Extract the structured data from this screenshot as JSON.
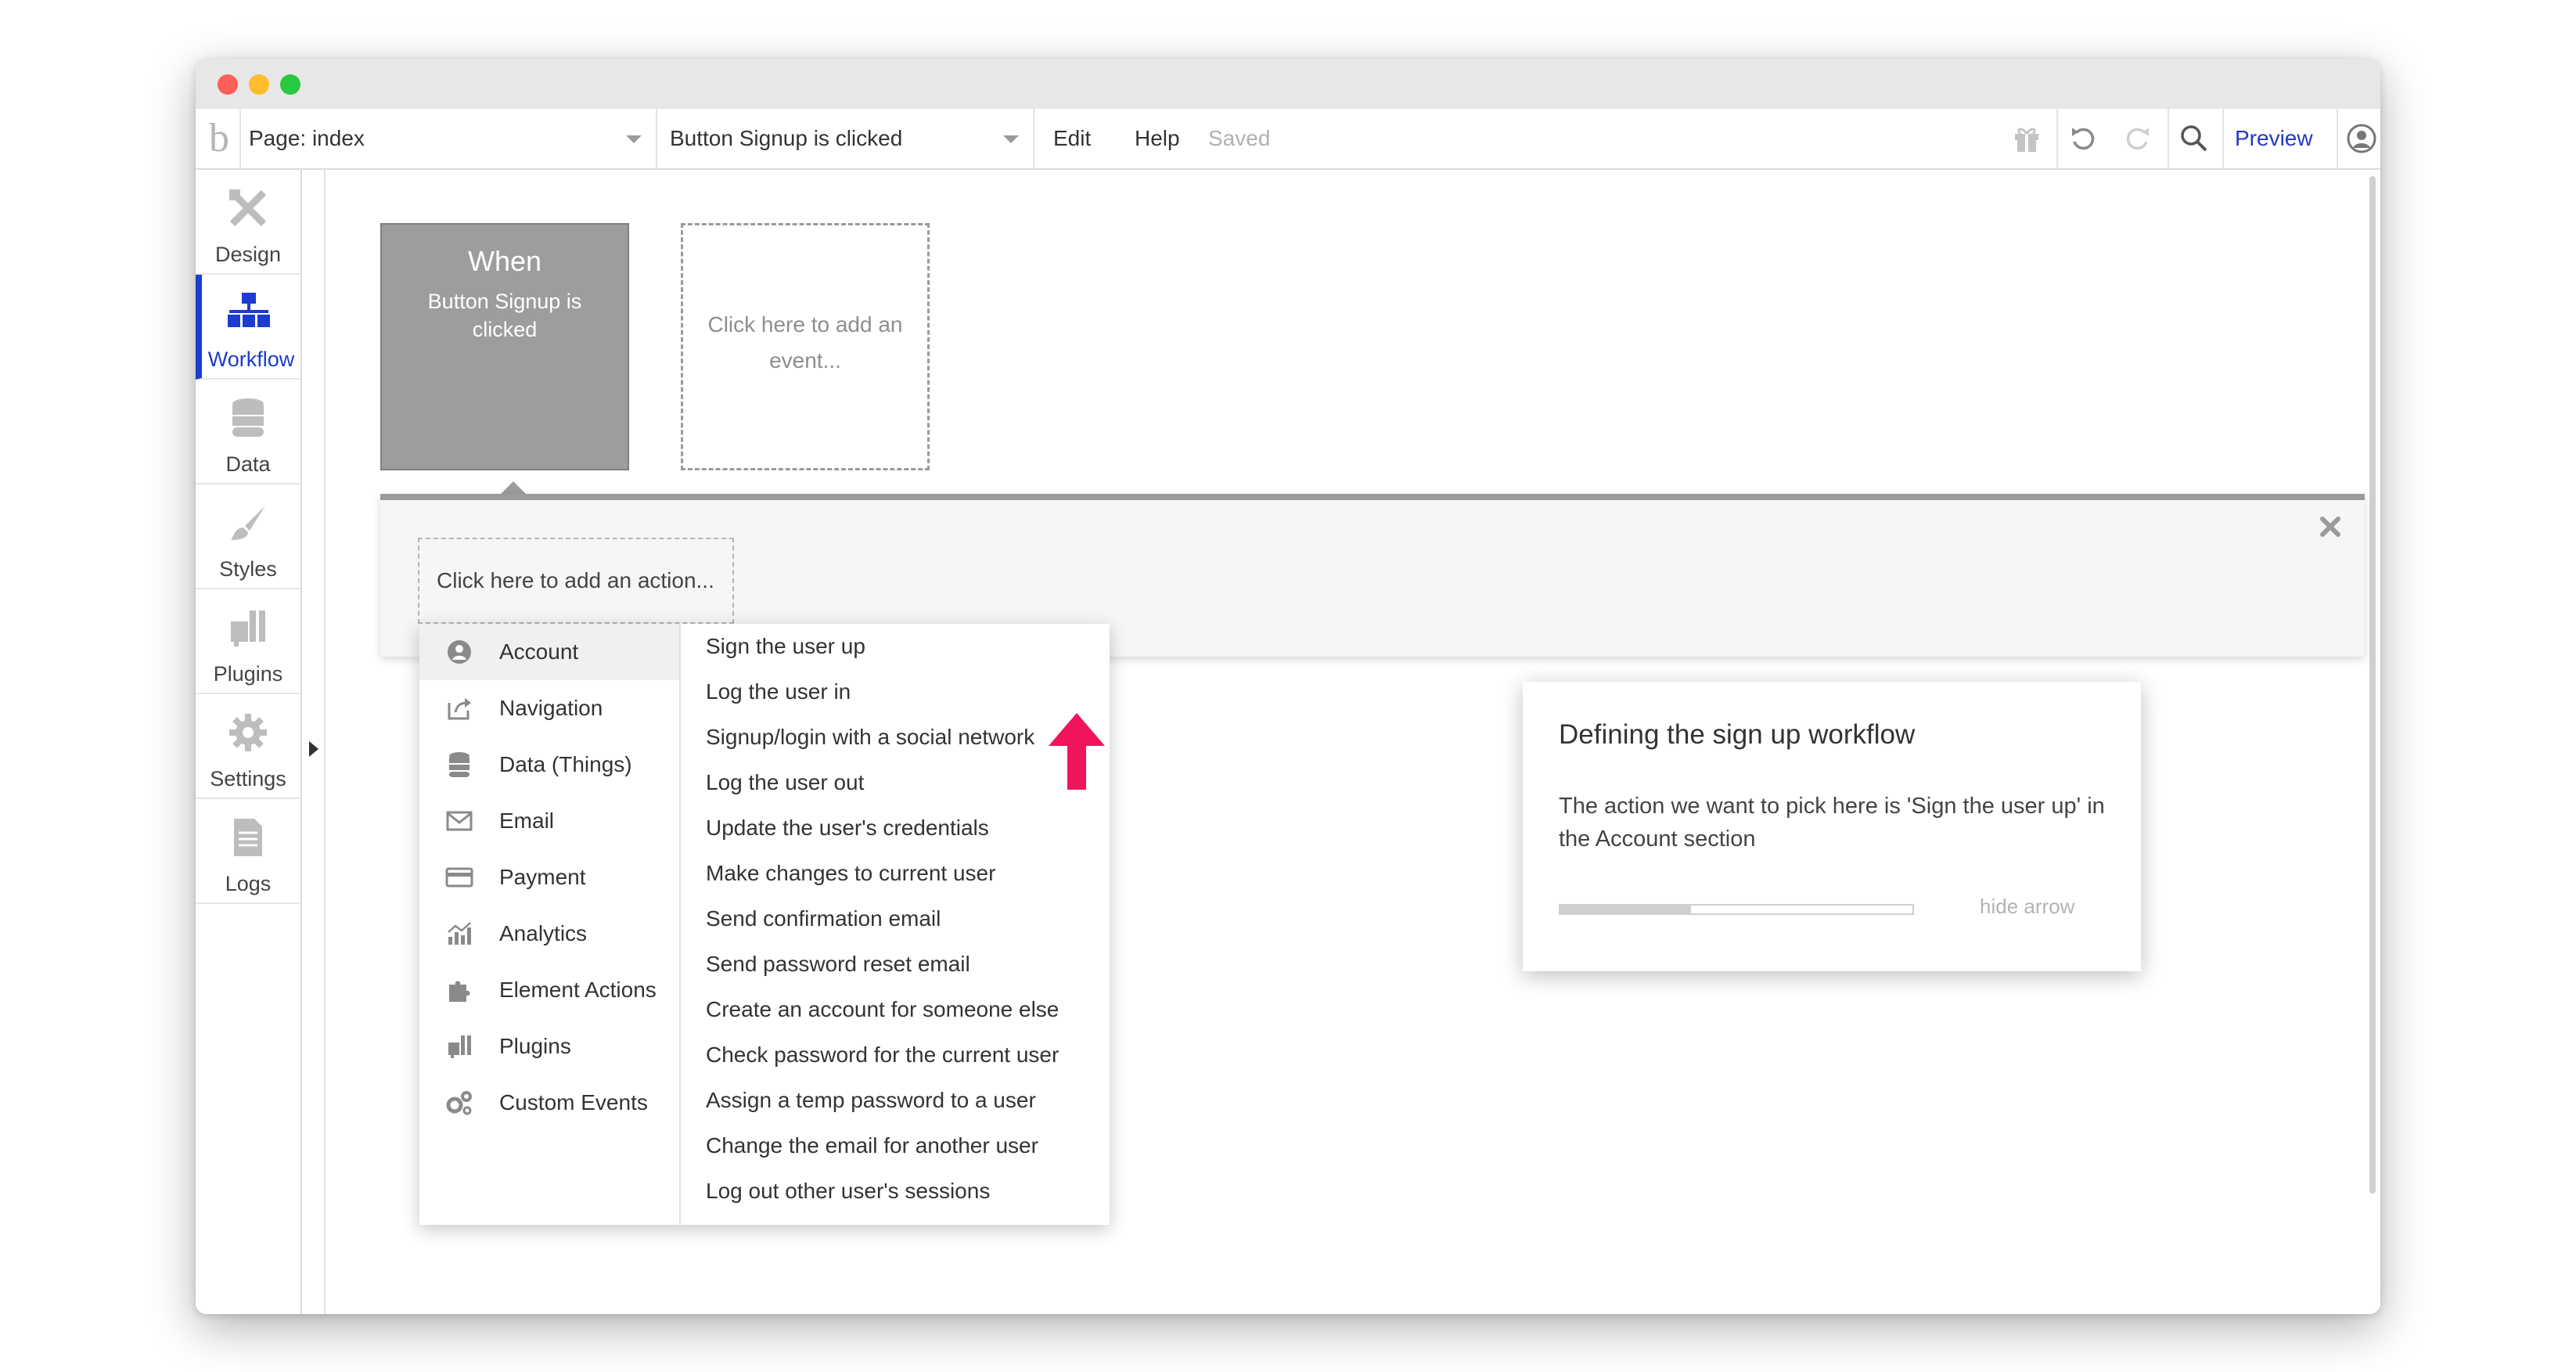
{
  "toolbar": {
    "logo": "b",
    "page_select": "Page: index",
    "event_select": "Button Signup is clicked",
    "edit": "Edit",
    "help": "Help",
    "status": "Saved",
    "preview": "Preview",
    "icons": [
      "gift-icon",
      "undo-icon",
      "redo-icon",
      "search-icon",
      "user-avatar-icon"
    ]
  },
  "sidebar": {
    "items": [
      {
        "label": "Design",
        "icon": "design-icon"
      },
      {
        "label": "Workflow",
        "icon": "workflow-icon",
        "active": true
      },
      {
        "label": "Data",
        "icon": "database-icon"
      },
      {
        "label": "Styles",
        "icon": "brush-icon"
      },
      {
        "label": "Plugins",
        "icon": "plug-icon"
      },
      {
        "label": "Settings",
        "icon": "gear-icon"
      },
      {
        "label": "Logs",
        "icon": "document-icon"
      }
    ]
  },
  "workflow": {
    "event_card": {
      "title": "When",
      "subtitle": "Button Signup is clicked"
    },
    "add_event": "Click here to add an event...",
    "add_action": "Click here to add an action..."
  },
  "action_menu": {
    "categories": [
      {
        "label": "Account",
        "icon": "account-icon",
        "selected": true
      },
      {
        "label": "Navigation",
        "icon": "navigation-icon"
      },
      {
        "label": "Data (Things)",
        "icon": "database-icon"
      },
      {
        "label": "Email",
        "icon": "email-icon"
      },
      {
        "label": "Payment",
        "icon": "credit-card-icon"
      },
      {
        "label": "Analytics",
        "icon": "analytics-icon"
      },
      {
        "label": "Element Actions",
        "icon": "puzzle-icon"
      },
      {
        "label": "Plugins",
        "icon": "plug-icon"
      },
      {
        "label": "Custom Events",
        "icon": "gears-icon"
      }
    ],
    "actions": [
      "Sign the user up",
      "Log the user in",
      "Signup/login with a social network",
      "Log the user out",
      "Update the user's credentials",
      "Make changes to current user",
      "Send confirmation email",
      "Send password reset email",
      "Create an account for someone else",
      "Check password for the current user",
      "Assign a temp password to a user",
      "Change the email for another user",
      "Log out other user's sessions"
    ]
  },
  "tooltip": {
    "title": "Defining the sign up workflow",
    "body": "The action we want to pick here is 'Sign the user up' in the Account section",
    "progress": 0.37,
    "hide_label": "hide arrow"
  },
  "colors": {
    "accent": "#1b3bd1",
    "arrow": "#f0145a",
    "event_card": "#9d9d9d"
  }
}
